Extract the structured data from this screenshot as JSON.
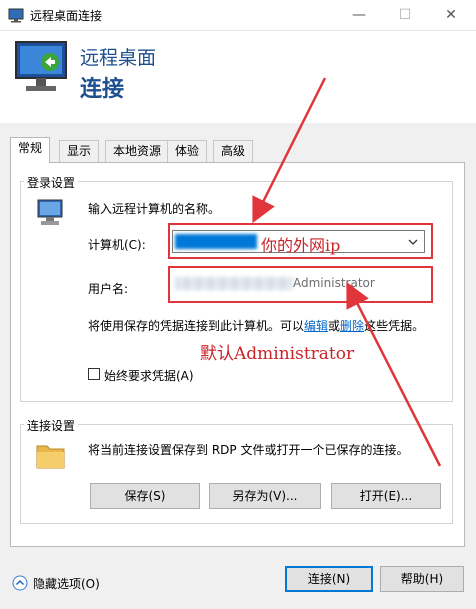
{
  "window": {
    "title": "远程桌面连接",
    "minimize": "—",
    "maximize": "☐",
    "close": "✕"
  },
  "header": {
    "line1": "远程桌面",
    "line2": "连接"
  },
  "tabs": [
    "常规",
    "显示",
    "本地资源",
    "体验",
    "高级"
  ],
  "login": {
    "group_label": "登录设置",
    "prompt": "输入远程计算机的名称。",
    "computer_label": "计算机(C):",
    "computer_value": "你的外网ip",
    "username_label": "用户名:",
    "username_value": "Administrator",
    "info_prefix": "将使用保存的凭据连接到此计算机。可以",
    "edit_link": "编辑",
    "or_text": "或",
    "delete_link": "删除",
    "info_suffix": "这些凭据。",
    "annotation": "默认Administrator",
    "always_ask_label": "始终要求凭据(A)",
    "always_ask_checked": false
  },
  "connection": {
    "group_label": "连接设置",
    "description": "将当前连接设置保存到 RDP 文件或打开一个已保存的连接。",
    "save_button": "保存(S)",
    "save_as_button": "另存为(V)...",
    "open_button": "打开(E)..."
  },
  "footer": {
    "hide_options": "隐藏选项(O)",
    "connect_button": "连接(N)",
    "help_button": "帮助(H)"
  },
  "colors": {
    "accent": "#0078d7",
    "annotation_red": "#e0363b",
    "header_text": "#1e4f8e"
  }
}
